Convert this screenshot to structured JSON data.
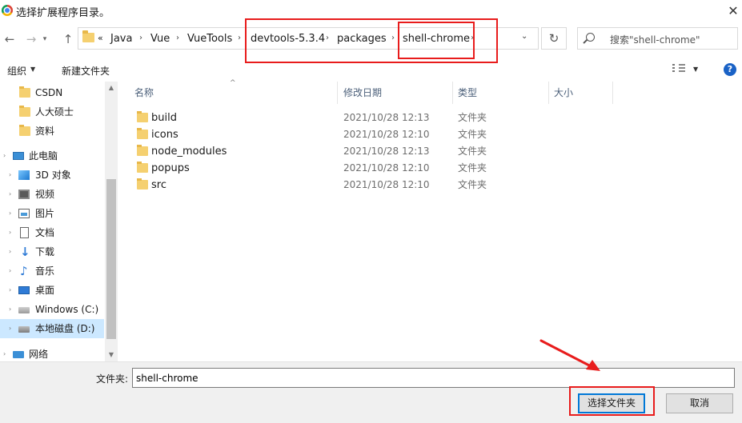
{
  "window": {
    "title": "选择扩展程序目录。",
    "close_label": "✕"
  },
  "nav": {
    "back_label": "←",
    "forward_label": "→",
    "recent_label": "▾",
    "up_label": "↑",
    "breadcrumbs": [
      "«",
      "Java",
      "Vue",
      "VueTools",
      "devtools-5.3.4",
      "packages",
      "shell-chrome"
    ],
    "breadcrumb_separator": "›",
    "dropdown_label": "⌄",
    "refresh_label": "↻"
  },
  "search": {
    "placeholder": "搜索\"shell-chrome\""
  },
  "toolbar": {
    "organize_label": "组织",
    "caret": "▼",
    "new_folder_label": "新建文件夹",
    "help_label": "?"
  },
  "nav_pane": {
    "items": [
      {
        "label": "CSDN",
        "icon": "folder-icon"
      },
      {
        "label": "人大硕士",
        "icon": "folder-icon"
      },
      {
        "label": "资料",
        "icon": "folder-icon"
      },
      {
        "label": "此电脑",
        "icon": "pc-icon"
      },
      {
        "label": "3D 对象",
        "icon": "3d-objects-icon"
      },
      {
        "label": "视频",
        "icon": "video-icon"
      },
      {
        "label": "图片",
        "icon": "pictures-icon"
      },
      {
        "label": "文档",
        "icon": "documents-icon"
      },
      {
        "label": "下载",
        "icon": "download-icon"
      },
      {
        "label": "音乐",
        "icon": "music-icon"
      },
      {
        "label": "桌面",
        "icon": "desktop-icon"
      },
      {
        "label": "Windows (C:)",
        "icon": "drive-icon"
      },
      {
        "label": "本地磁盘 (D:)",
        "icon": "drive-icon",
        "selected": true
      },
      {
        "label": "网络",
        "icon": "network-icon"
      }
    ],
    "expander": "›",
    "scroll_up": "▲",
    "scroll_down": "▼"
  },
  "columns": {
    "name": "名称",
    "date": "修改日期",
    "type": "类型",
    "size": "大小",
    "sort_indicator": "^"
  },
  "files": [
    {
      "name": "build",
      "date": "2021/10/28 12:13",
      "type": "文件夹"
    },
    {
      "name": "icons",
      "date": "2021/10/28 12:10",
      "type": "文件夹"
    },
    {
      "name": "node_modules",
      "date": "2021/10/28 12:13",
      "type": "文件夹"
    },
    {
      "name": "popups",
      "date": "2021/10/28 12:10",
      "type": "文件夹"
    },
    {
      "name": "src",
      "date": "2021/10/28 12:10",
      "type": "文件夹"
    }
  ],
  "footer": {
    "folder_label": "文件夹:",
    "folder_value": "shell-chrome",
    "select_button": "选择文件夹",
    "cancel_button": "取消"
  },
  "colors": {
    "highlight": "#e81c1c",
    "selection": "#cce8ff",
    "accent": "#0078d7"
  }
}
